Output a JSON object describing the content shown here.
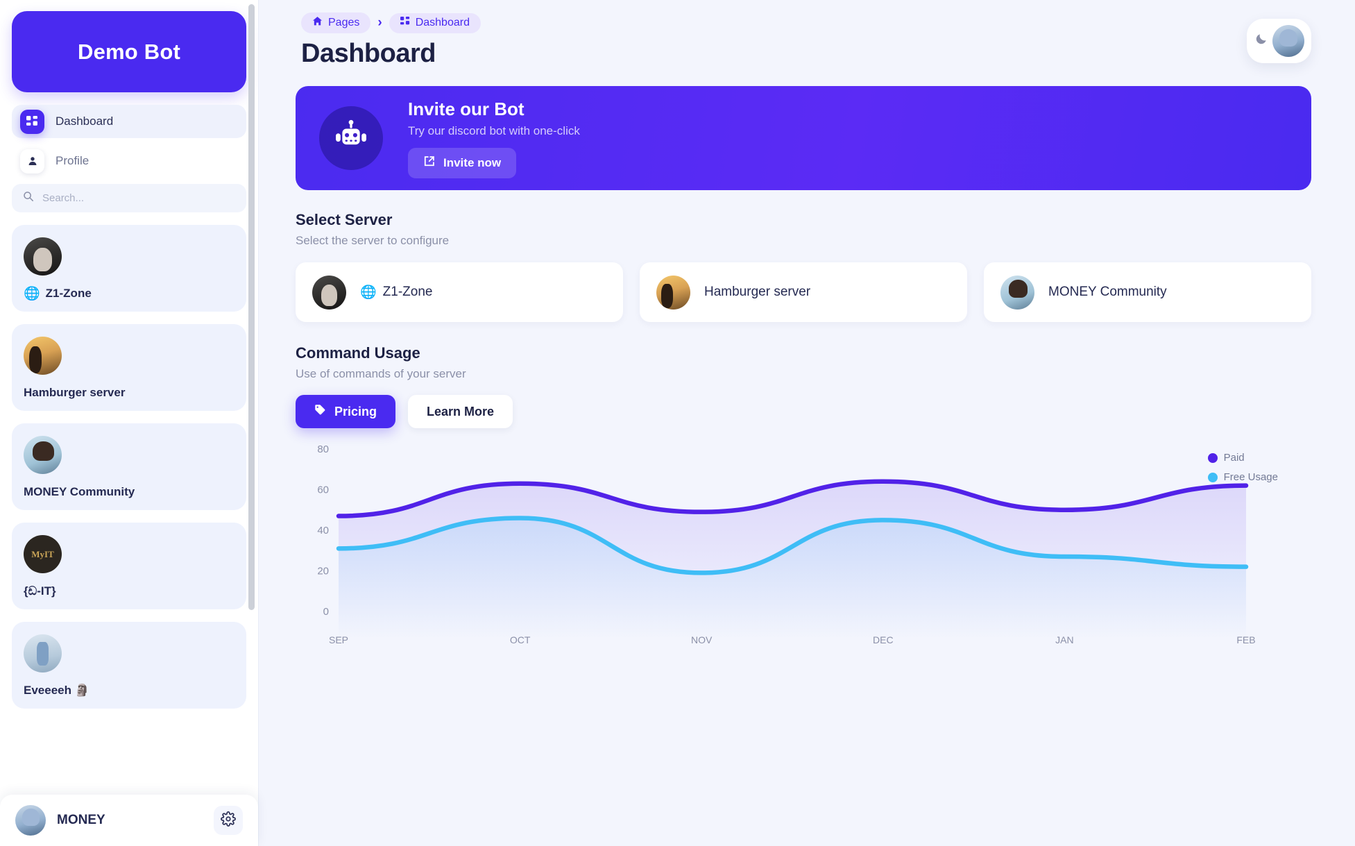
{
  "sidebar": {
    "brand": "Demo Bot",
    "nav": [
      {
        "label": "Dashboard",
        "icon": "grid-icon",
        "active": true
      },
      {
        "label": "Profile",
        "icon": "person-icon",
        "active": false
      }
    ],
    "search": {
      "placeholder": "Search...",
      "value": "",
      "icon": "search-icon"
    },
    "servers": [
      {
        "name": "Z1-Zone",
        "has_globe": true,
        "avatar": "av-z1"
      },
      {
        "name": "Hamburger server",
        "has_globe": false,
        "avatar": "av-ham"
      },
      {
        "name": "MONEY Community",
        "has_globe": false,
        "avatar": "av-money"
      },
      {
        "name": "{ඩ-IT}",
        "has_globe": false,
        "avatar": "av-myit"
      },
      {
        "name": "Eveeeeh 🗿",
        "has_globe": false,
        "avatar": "av-evee"
      }
    ],
    "footer": {
      "username": "MONEY",
      "settings_icon": "gear-icon",
      "avatar": "av-me"
    }
  },
  "header": {
    "breadcrumb": [
      {
        "label": "Pages",
        "icon": "home-icon"
      },
      {
        "label": "Dashboard",
        "icon": "grid-icon"
      }
    ],
    "separator": "›",
    "title": "Dashboard",
    "theme_toggle_icon": "moon-icon"
  },
  "banner": {
    "icon": "robot-icon",
    "title": "Invite our Bot",
    "subtitle": "Try our discord bot with one-click",
    "button": {
      "label": "Invite now",
      "icon": "external-link-icon"
    }
  },
  "select_server": {
    "title": "Select Server",
    "subtitle": "Select the server to configure",
    "cards": [
      {
        "name": "Z1-Zone",
        "has_globe": true,
        "avatar": "av-z1"
      },
      {
        "name": "Hamburger server",
        "has_globe": false,
        "avatar": "av-ham"
      },
      {
        "name": "MONEY Community",
        "has_globe": false,
        "avatar": "av-money"
      }
    ]
  },
  "command_usage": {
    "title": "Command Usage",
    "subtitle": "Use of commands of your server",
    "buttons": {
      "pricing": {
        "label": "Pricing",
        "icon": "tag-icon"
      },
      "learn_more": {
        "label": "Learn More"
      }
    }
  },
  "colors": {
    "brand_purple": "#4a2af0",
    "paid_line": "#5122e8",
    "free_line": "#3fbdf6",
    "page_bg": "#f3f5fd",
    "text_dark": "#1d2144",
    "text_muted": "#8b90a8",
    "globe_blue": "#1ea8f0"
  },
  "chart_data": {
    "type": "line",
    "title": "Command Usage",
    "xlabel": "",
    "ylabel": "",
    "categories": [
      "SEP",
      "OCT",
      "NOV",
      "DEC",
      "JAN",
      "FEB"
    ],
    "ylim": [
      0,
      80
    ],
    "yticks": [
      0,
      20,
      40,
      60,
      80
    ],
    "grid": false,
    "legend_position": "top-right",
    "smooth": true,
    "series": [
      {
        "name": "Paid",
        "color": "#5122e8",
        "values": [
          47,
          63,
          49,
          64,
          50,
          62
        ]
      },
      {
        "name": "Free Usage",
        "color": "#3fbdf6",
        "values": [
          31,
          46,
          19,
          45,
          27,
          22
        ]
      }
    ]
  }
}
